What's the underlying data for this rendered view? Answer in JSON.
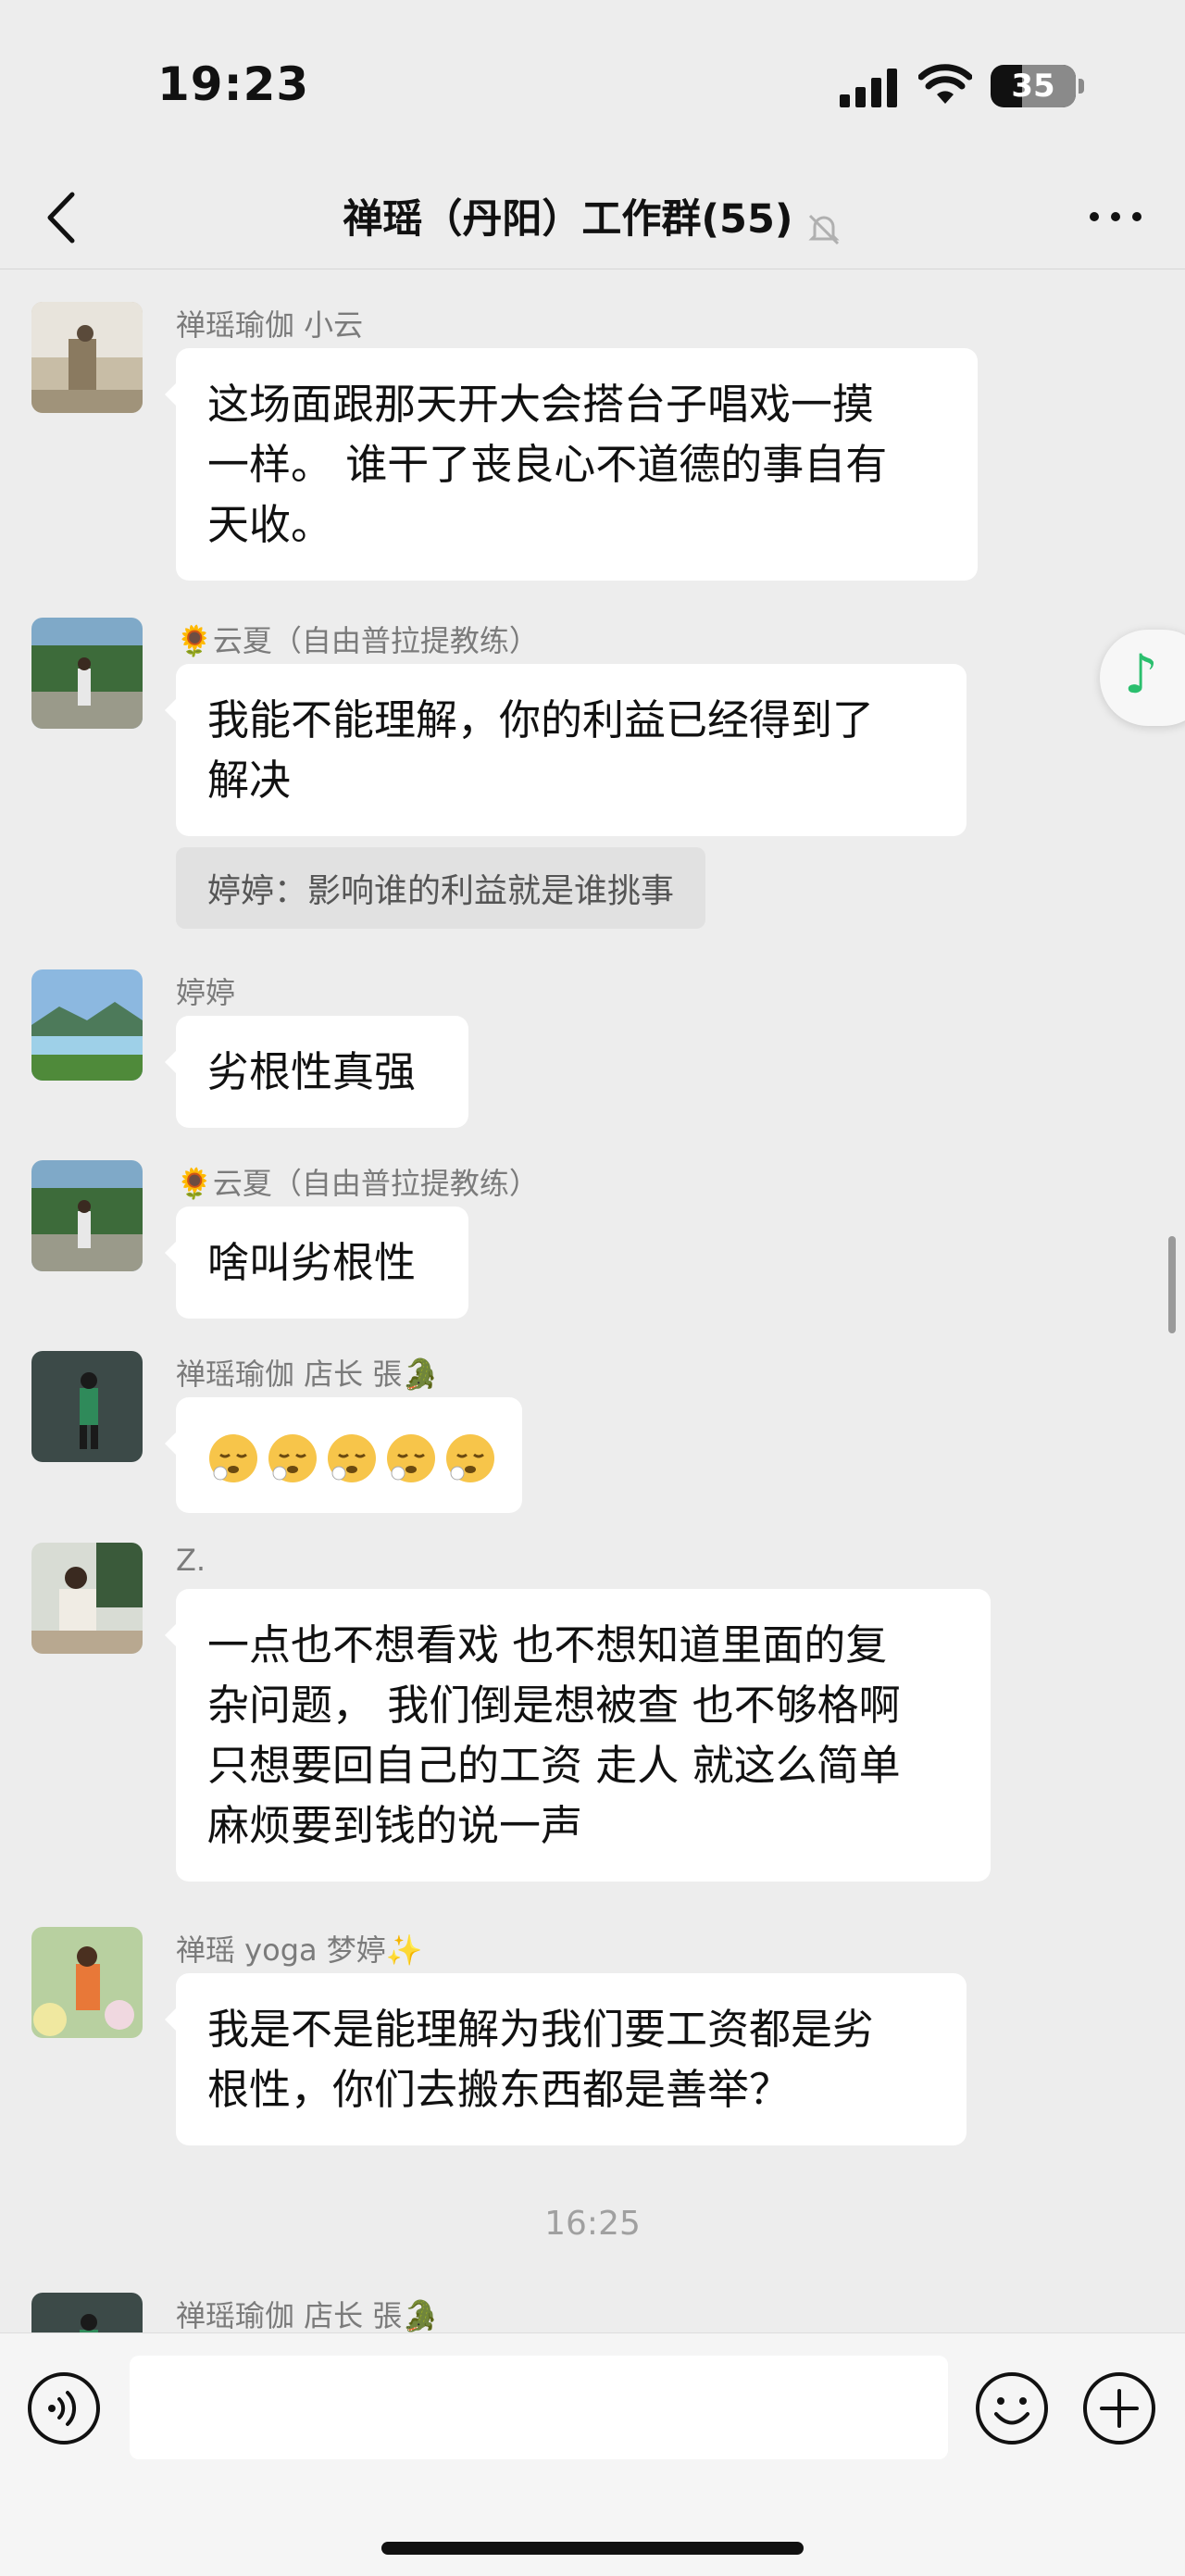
{
  "status_bar": {
    "time": "19:23",
    "battery": "35"
  },
  "nav": {
    "title": "禅瑶（丹阳）工作群(55)"
  },
  "messages": [
    {
      "sender": "禅瑶瑜伽 小云",
      "lines": [
        "这场面跟那天开大会搭台子唱戏一摸",
        "一样。 谁干了丧良心不道德的事自有",
        "天收。"
      ]
    },
    {
      "sender": "🌻云夏（自由普拉提教练）",
      "lines": [
        "我能不能理解，你的利益已经得到了",
        "解决"
      ],
      "quote": "婷婷：影响谁的利益就是谁挑事"
    },
    {
      "sender": "婷婷",
      "lines": [
        "劣根性真强"
      ]
    },
    {
      "sender": "🌻云夏（自由普拉提教练）",
      "lines": [
        "啥叫劣根性"
      ]
    },
    {
      "sender": "禅瑶瑜伽  店长 張🐊",
      "emoji_count": 5
    },
    {
      "sender": "Z.",
      "lines": [
        "一点也不想看戏 也不想知道里面的复",
        "杂问题， 我们倒是想被查 也不够格啊",
        "只想要回自己的工资 走人 就这么简单",
        "麻烦要到钱的说一声"
      ]
    },
    {
      "sender": "禅瑶 yoga 梦婷✨",
      "lines": [
        "我是不是能理解为我们要工资都是劣",
        "根性，你们去搬东西都是善举？"
      ]
    },
    {
      "sender": "禅瑶瑜伽  店长 張🐊"
    }
  ],
  "timestamp": "16:25",
  "input": {
    "value": ""
  },
  "icons": {
    "back": "chevron-left-icon",
    "mute": "bell-off-icon",
    "more": "more-dots-icon",
    "voice": "voice-icon",
    "emoji": "smiley-icon",
    "plus": "plus-icon",
    "float": "music-note-icon"
  },
  "colors": {
    "background": "#ededed",
    "bubble": "#ffffff",
    "quote": "#e1e1e1",
    "accent": "#2bbf6e"
  }
}
